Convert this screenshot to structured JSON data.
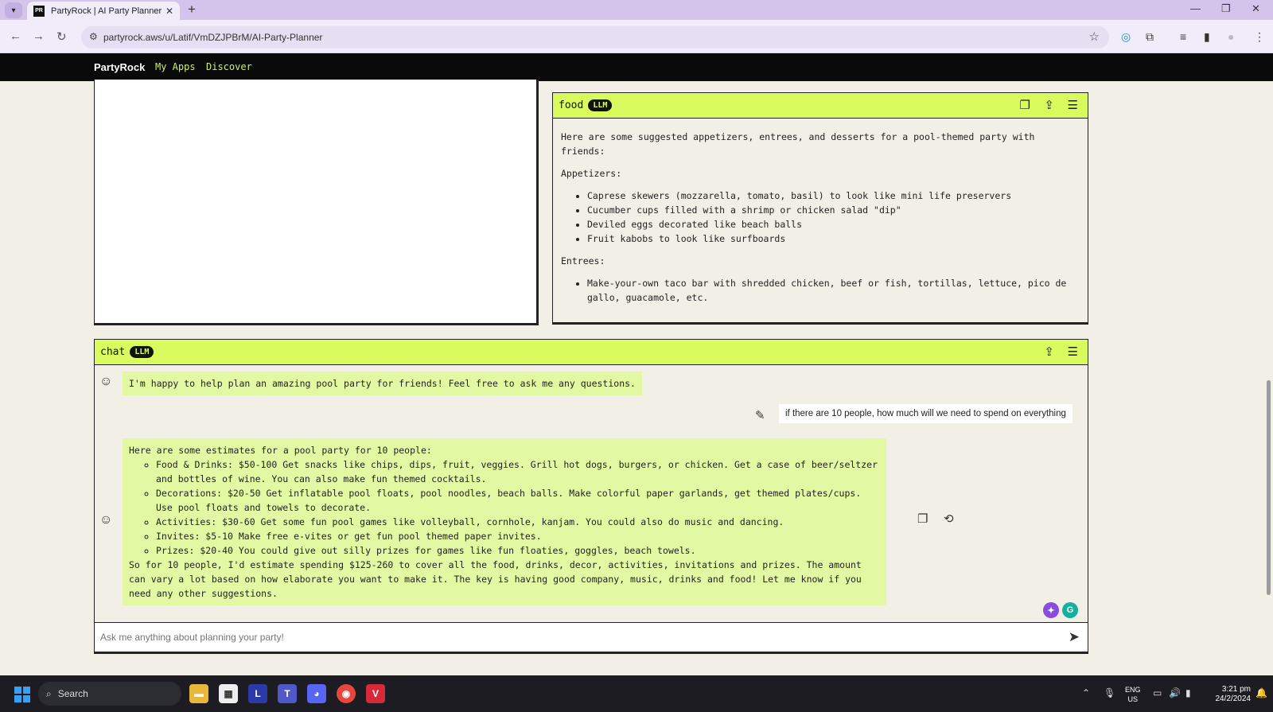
{
  "browser": {
    "tab_title": "PartyRock | AI Party Planner",
    "favicon_text": "PR",
    "url": "partyrock.aws/u/Latif/VmDZJPBrM/AI-Party-Planner"
  },
  "app_nav": {
    "brand": "PartyRock",
    "links": [
      "My Apps",
      "Discover"
    ]
  },
  "food_widget": {
    "title": "food",
    "badge": "LLM",
    "intro": "Here are some suggested appetizers, entrees, and desserts for a pool-themed party with friends:",
    "appetizers_heading": "Appetizers:",
    "appetizers": [
      "Caprese skewers (mozzarella, tomato, basil) to look like mini life preservers",
      "Cucumber cups filled with a shrimp or chicken salad \"dip\"",
      "Deviled eggs decorated like beach balls",
      "Fruit kabobs to look like surfboards"
    ],
    "entrees_heading": "Entrees:",
    "entrees": [
      "Make-your-own taco bar with shredded chicken, beef or fish, tortillas, lettuce, pico de gallo, guacamole, etc."
    ]
  },
  "chat_widget": {
    "title": "chat",
    "badge": "LLM",
    "greeting": "I'm happy to help plan an amazing pool party for friends! Feel free to ask me any questions.",
    "user_message": "if there are 10 people, how much will we need to spend on everything",
    "reply_intro": "Here are some estimates for a pool party for 10 people:",
    "reply_items": [
      "Food & Drinks: $50-100 Get snacks like chips, dips, fruit, veggies. Grill hot dogs, burgers, or chicken. Get a case of beer/seltzer and bottles of wine. You can also make fun themed cocktails.",
      "Decorations: $20-50 Get inflatable pool floats, pool noodles, beach balls. Make colorful paper garlands, get themed plates/cups. Use pool floats and towels to decorate.",
      "Activities: $30-60 Get some fun pool games like volleyball, cornhole, kanjam. You could also do music and dancing.",
      "Invites: $5-10 Make free e-vites or get fun pool themed paper invites.",
      "Prizes: $20-40 You could give out silly prizes for games like fun floaties, goggles, beach towels."
    ],
    "reply_outro": "So for 10 people, I'd estimate spending $125-260 to cover all the food, drinks, decor, activities, invitations and prizes. The amount can vary a lot based on how elaborate you want to make it. The key is having good company, music, drinks and food! Let me know if you need any other suggestions.",
    "input_placeholder": "Ask me anything about planning your party!"
  },
  "taskbar": {
    "search_label": "Search",
    "language": "ENG",
    "region": "US",
    "time": "3:21 pm",
    "date": "24/2/2024"
  },
  "colors": {
    "accent": "#d9fb5e",
    "ai_bubble": "#e3f8a3",
    "nav_link": "#c9f25a"
  }
}
